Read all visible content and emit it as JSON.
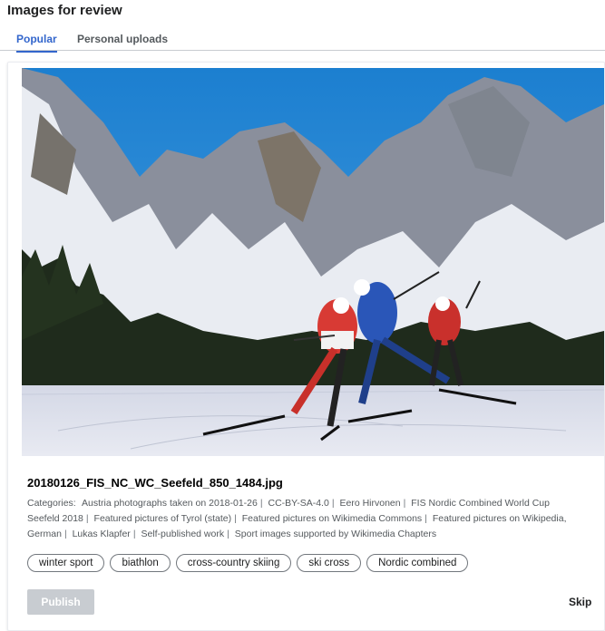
{
  "page": {
    "title": "Images for review"
  },
  "tabs": [
    {
      "label": "Popular",
      "active": true
    },
    {
      "label": "Personal uploads",
      "active": false
    }
  ],
  "card": {
    "filename": "20180126_FIS_NC_WC_Seefeld_850_1484.jpg",
    "categories_label": "Categories:",
    "categories": [
      "Austria photographs taken on 2018-01-26",
      "CC-BY-SA-4.0",
      "Eero Hirvonen",
      "FIS Nordic Combined World Cup Seefeld 2018",
      "Featured pictures of Tyrol (state)",
      "Featured pictures on Wikimedia Commons",
      "Featured pictures on Wikipedia, German",
      "Lukas Klapfer",
      "Self-published work",
      "Sport images supported by Wikimedia Chapters"
    ],
    "tags": [
      "winter sport",
      "biathlon",
      "cross-country skiing",
      "ski cross",
      "Nordic combined"
    ],
    "publish_label": "Publish",
    "skip_label": "Skip"
  },
  "colors": {
    "accent": "#3366cc",
    "disabled_button": "#c8ccd1",
    "border": "#72777d"
  }
}
